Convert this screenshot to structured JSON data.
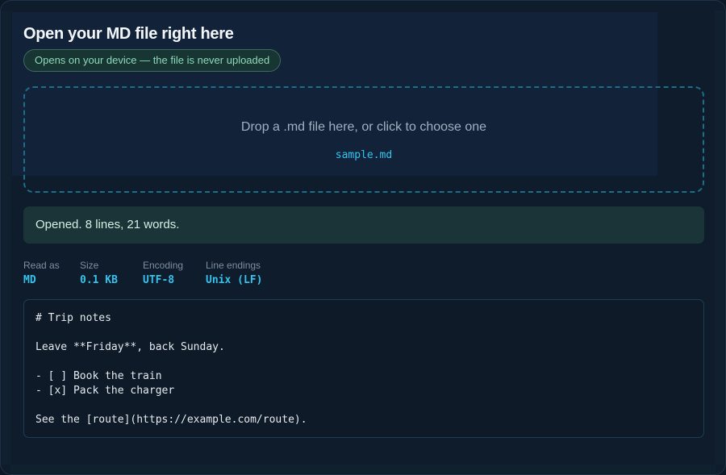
{
  "header": {
    "title": "Open your MD file right here",
    "privacy_note": "Opens on your device — the file is never uploaded"
  },
  "dropzone": {
    "prompt": "Drop a .md file here, or click to choose one",
    "filename": "sample.md"
  },
  "status": {
    "message": "Opened. 8 lines, 21 words."
  },
  "meta": [
    {
      "label": "Read as",
      "value": "MD"
    },
    {
      "label": "Size",
      "value": "0.1 KB"
    },
    {
      "label": "Encoding",
      "value": "UTF-8"
    },
    {
      "label": "Line endings",
      "value": "Unix (LF)"
    }
  ],
  "preview": {
    "content": "# Trip notes\n\nLeave **Friday**, back Sunday.\n\n- [ ] Book the train\n- [x] Pack the charger\n\nSee the [route](https://example.com/route)."
  },
  "colors": {
    "accent": "#33c3ee",
    "success_bg": "#1a3438",
    "success_text": "#8fd9b8",
    "background": "#0f1c2b"
  }
}
